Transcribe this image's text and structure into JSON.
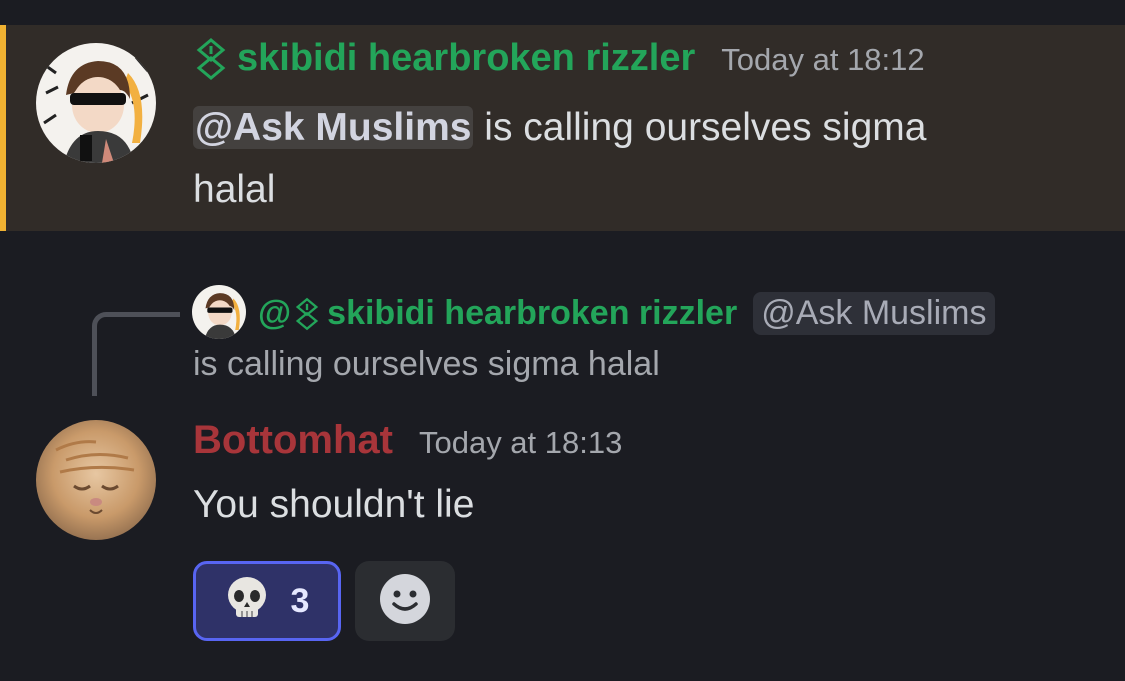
{
  "message1": {
    "username": "skibidi hearbroken rizzler",
    "role_icon": "role-glyph-icon",
    "timestamp": "Today at 18:12",
    "mention": "@Ask Muslims",
    "text_after_mention": " is calling ourselves sigma",
    "text_line2": "halal",
    "highlight_color": "#f0b232",
    "username_color": "#23a55a"
  },
  "reply": {
    "at": "@",
    "username": "skibidi hearbroken rizzler",
    "mention": "@Ask Muslims",
    "text": "is calling ourselves sigma halal"
  },
  "message2": {
    "username": "Bottomhat",
    "username_color": "#a8353a",
    "timestamp": "Today at 18:13",
    "text": "You shouldn't lie"
  },
  "reactions": [
    {
      "emoji": "skull-emoji",
      "count": "3",
      "active": true
    },
    {
      "emoji": "add-reaction-icon",
      "count": "",
      "active": false
    }
  ]
}
